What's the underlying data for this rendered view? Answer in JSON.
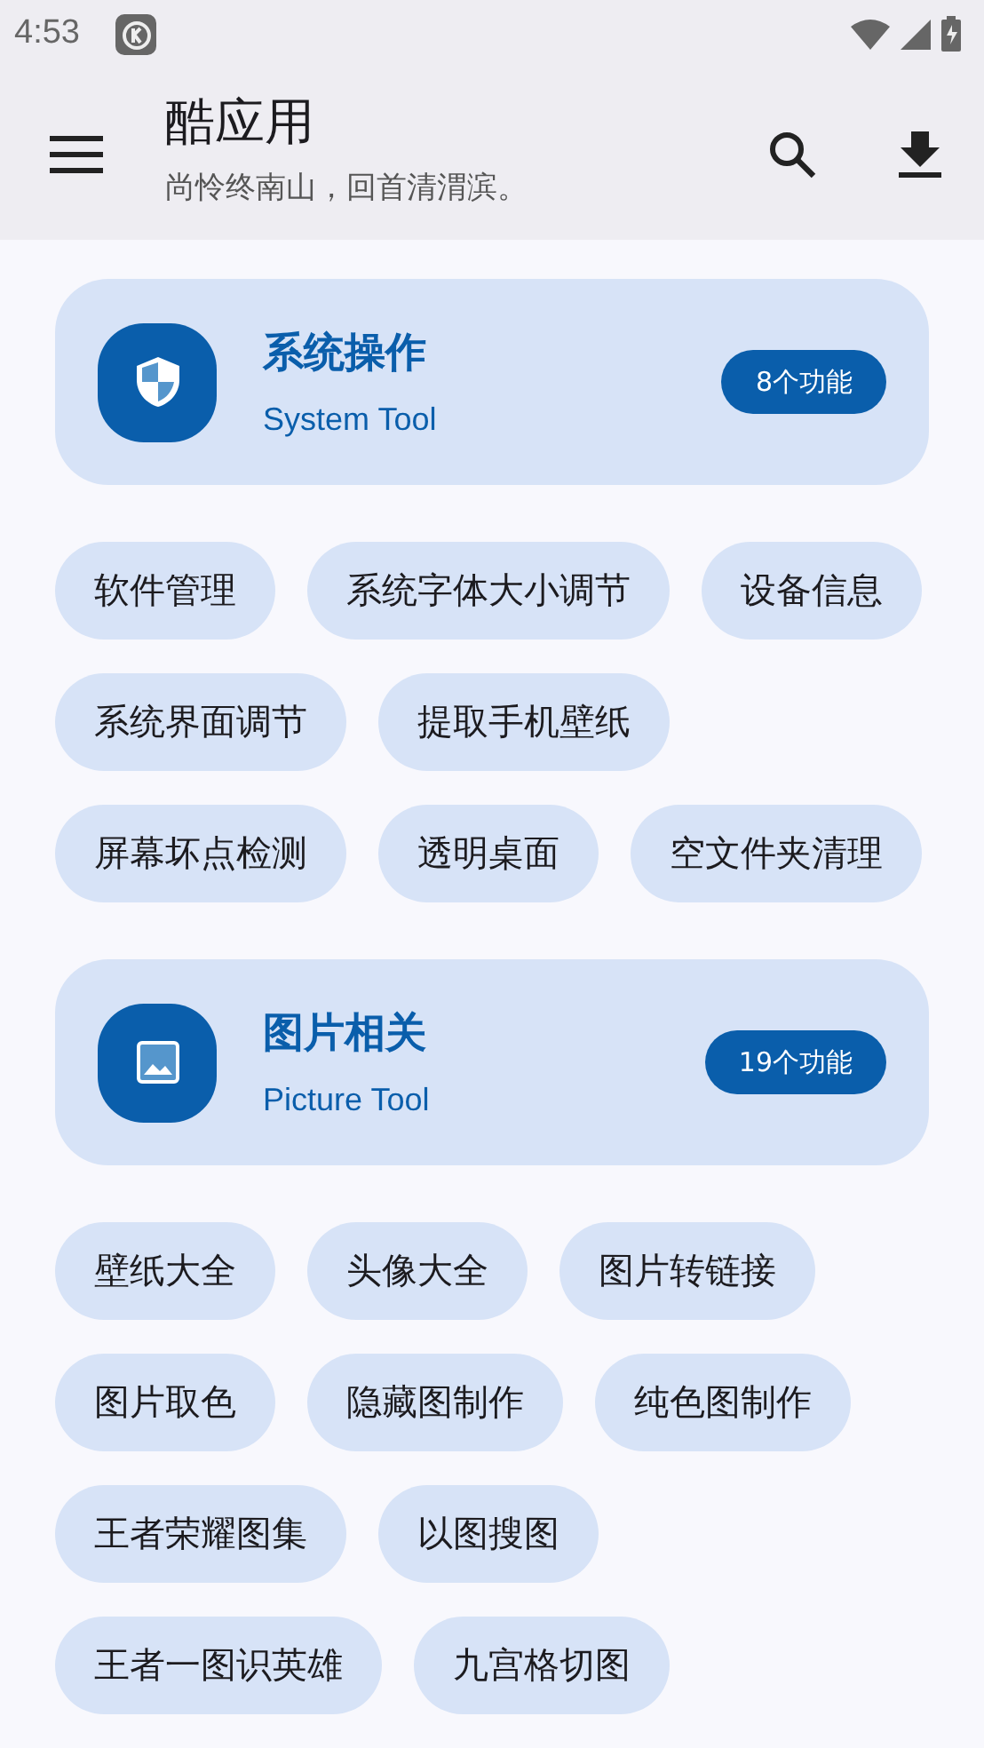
{
  "status_bar": {
    "time": "4:53"
  },
  "app_bar": {
    "title": "酷应用",
    "subtitle": "尚怜终南山，回首清渭滨。"
  },
  "sections": [
    {
      "title": "系统操作",
      "subtitle": "System Tool",
      "count": "8个功能",
      "tools": [
        "软件管理",
        "系统字体大小调节",
        "设备信息",
        "系统界面调节",
        "提取手机壁纸",
        "屏幕坏点检测",
        "透明桌面",
        "空文件夹清理"
      ]
    },
    {
      "title": "图片相关",
      "subtitle": "Picture Tool",
      "count": "19个功能",
      "tools": [
        "壁纸大全",
        "头像大全",
        "图片转链接",
        "图片取色",
        "隐藏图制作",
        "纯色图制作",
        "王者荣耀图集",
        "以图搜图",
        "王者一图识英雄",
        "九宫格切图"
      ]
    }
  ]
}
